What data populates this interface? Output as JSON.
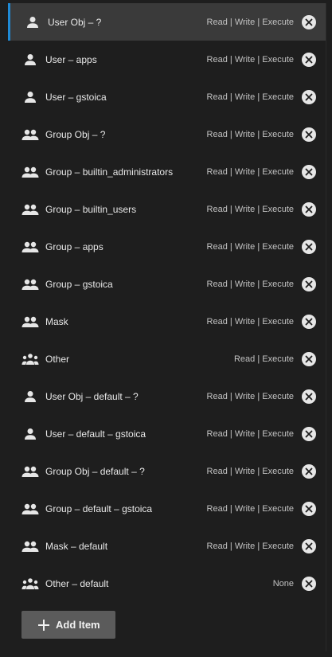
{
  "acl_entries": [
    {
      "name": "User Obj – ?",
      "perms": "Read | Write | Execute",
      "icon": "user-icon",
      "active": true
    },
    {
      "name": "User – apps",
      "perms": "Read | Write | Execute",
      "icon": "user-icon"
    },
    {
      "name": "User – gstoica",
      "perms": "Read | Write | Execute",
      "icon": "user-icon"
    },
    {
      "name": "Group Obj – ?",
      "perms": "Read | Write | Execute",
      "icon": "group-icon"
    },
    {
      "name": "Group – builtin_administrators",
      "perms": "Read | Write | Execute",
      "icon": "group-icon"
    },
    {
      "name": "Group – builtin_users",
      "perms": "Read | Write | Execute",
      "icon": "group-icon"
    },
    {
      "name": "Group – apps",
      "perms": "Read | Write | Execute",
      "icon": "group-icon"
    },
    {
      "name": "Group – gstoica",
      "perms": "Read | Write | Execute",
      "icon": "group-icon"
    },
    {
      "name": "Mask",
      "perms": "Read | Write | Execute",
      "icon": "group-icon"
    },
    {
      "name": "Other",
      "perms": "Read | Execute",
      "icon": "everyone-icon"
    },
    {
      "name": "User Obj – default – ?",
      "perms": "Read | Write | Execute",
      "icon": "user-icon"
    },
    {
      "name": "User – default – gstoica",
      "perms": "Read | Write | Execute",
      "icon": "user-icon"
    },
    {
      "name": "Group Obj – default – ?",
      "perms": "Read | Write | Execute",
      "icon": "group-icon"
    },
    {
      "name": "Group – default – gstoica",
      "perms": "Read | Write | Execute",
      "icon": "group-icon"
    },
    {
      "name": "Mask – default",
      "perms": "Read | Write | Execute",
      "icon": "group-icon"
    },
    {
      "name": "Other – default",
      "perms": "None",
      "icon": "everyone-icon"
    }
  ],
  "add_button": {
    "label": "Add Item",
    "icon": "plus-icon"
  },
  "colors": {
    "background": "#1e1e1e",
    "active_row": "#3a3a3a",
    "accent": "#1f8ad6",
    "button": "#5b5b5b"
  }
}
